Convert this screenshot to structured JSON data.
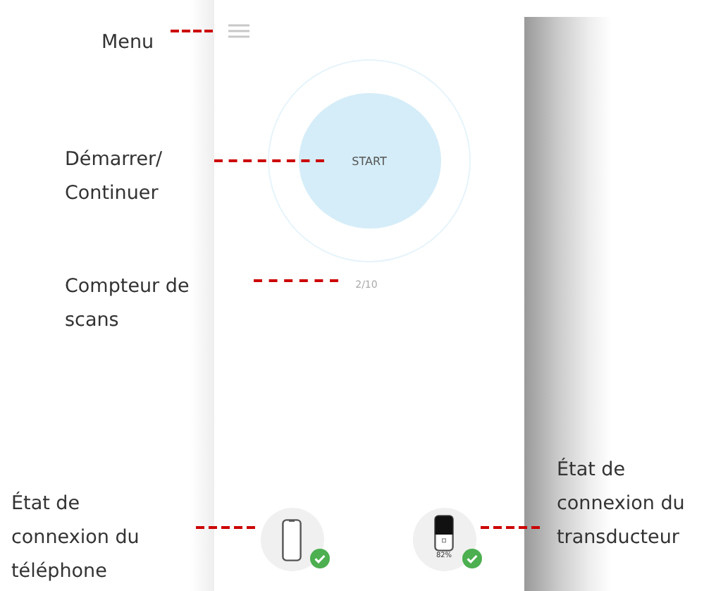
{
  "callouts": [
    {
      "lines": [
        "Menu"
      ]
    },
    {
      "lines": [
        "Démarrer/",
        "Continuer"
      ]
    },
    {
      "lines": [
        "Compteur de",
        "scans"
      ]
    },
    {
      "lines": [
        "État de",
        "connexion du",
        "téléphone"
      ]
    },
    {
      "lines": [
        "État de",
        "connexion du",
        "transducteur"
      ]
    }
  ],
  "screen": {
    "start_button": "START",
    "scan_counter": "2/10",
    "devices": [
      {
        "kind": "phone",
        "connected": true
      },
      {
        "kind": "transducer",
        "connected": true,
        "battery": "82%"
      }
    ]
  }
}
